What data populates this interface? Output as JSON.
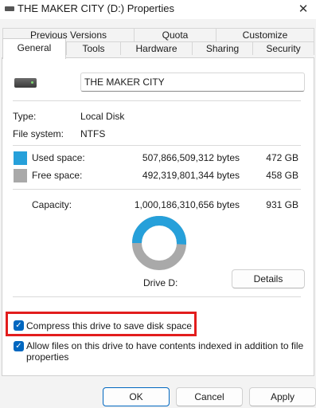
{
  "window": {
    "title": "THE MAKER CITY (D:) Properties",
    "close_glyph": "✕"
  },
  "tabs": {
    "top_row": [
      "Previous Versions",
      "Quota",
      "Customize"
    ],
    "bottom_row": [
      "General",
      "Tools",
      "Hardware",
      "Sharing",
      "Security"
    ],
    "active": "General"
  },
  "general": {
    "volume_name": "THE MAKER CITY",
    "type_label": "Type:",
    "type_value": "Local Disk",
    "fs_label": "File system:",
    "fs_value": "NTFS",
    "used_label": "Used space:",
    "used_bytes": "507,866,509,312 bytes",
    "used_gb": "472 GB",
    "free_label": "Free space:",
    "free_bytes": "492,319,801,344 bytes",
    "free_gb": "458 GB",
    "capacity_label": "Capacity:",
    "capacity_bytes": "1,000,186,310,656 bytes",
    "capacity_gb": "931 GB",
    "drive_label": "Drive D:",
    "details_button": "Details",
    "used_fraction": 0.508
  },
  "options": {
    "compress_label": "Compress this drive to save disk space",
    "compress_checked": true,
    "index_label_line1": "Allow files on this drive to have contents indexed in addition to file",
    "index_label_line2": "properties",
    "index_checked": true
  },
  "footer": {
    "ok": "OK",
    "cancel": "Cancel",
    "apply": "Apply"
  },
  "colors": {
    "used": "#26a0da",
    "free": "#a9a9a9",
    "accent": "#0067c0",
    "highlight": "#e21d1d"
  },
  "icons": {
    "drive": "drive-icon",
    "checkbox": "checkmark-icon",
    "close": "close-icon"
  }
}
